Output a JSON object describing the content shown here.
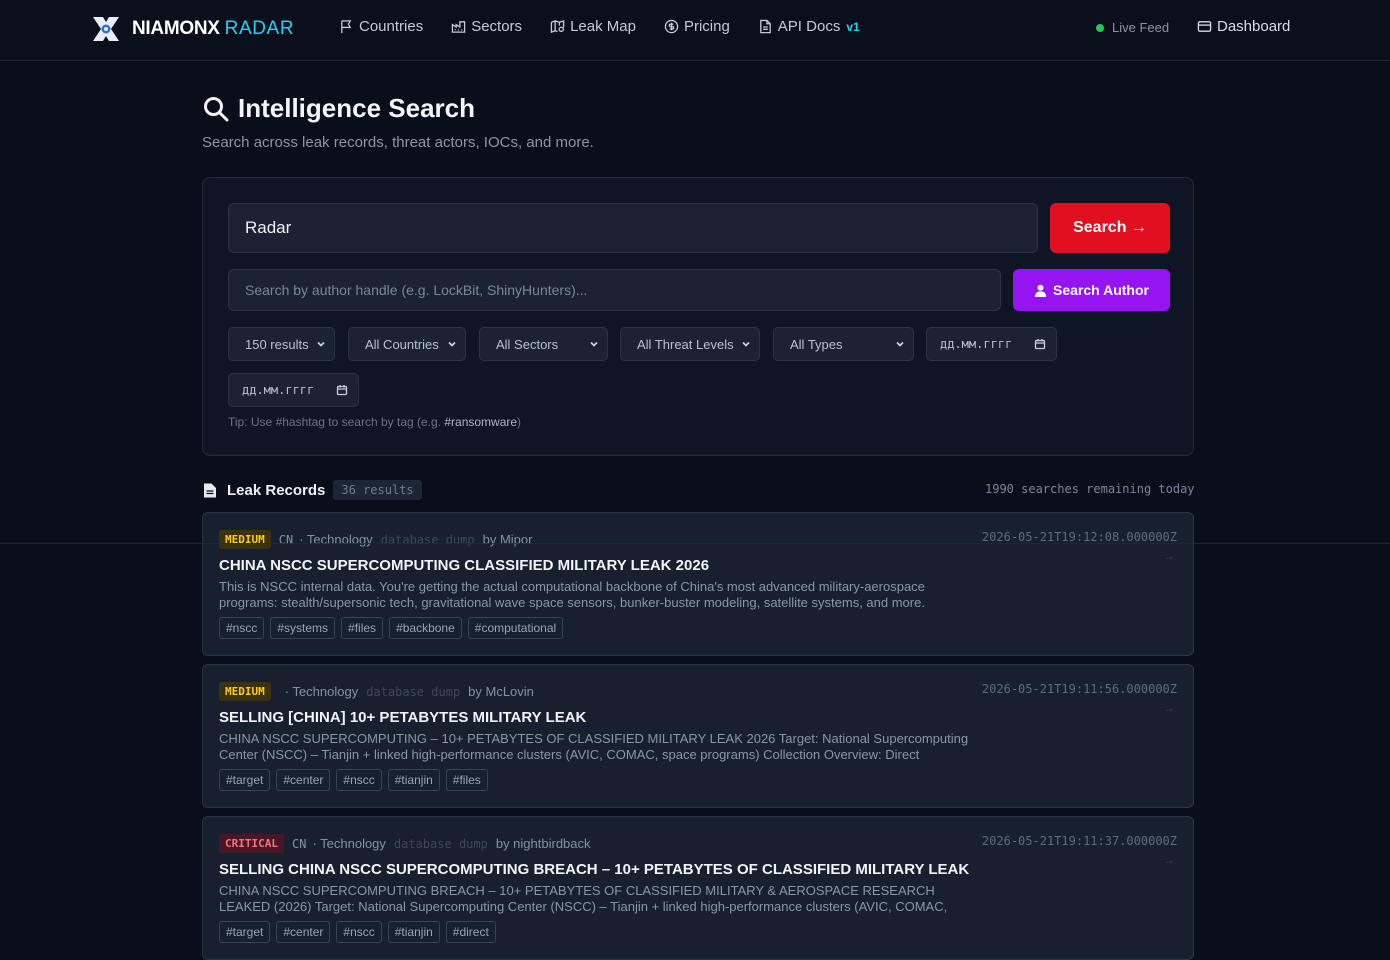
{
  "nav": {
    "logo_main": "NIAMONX",
    "logo_accent": "RADAR",
    "links": [
      {
        "label": "Countries",
        "icon": "flag-icon"
      },
      {
        "label": "Sectors",
        "icon": "factory-icon"
      },
      {
        "label": "Leak Map",
        "icon": "map-pin-icon"
      },
      {
        "label": "Pricing",
        "icon": "dollar-circle-icon"
      },
      {
        "label": "API Docs",
        "icon": "document-icon",
        "badge": "v1"
      }
    ],
    "live_feed": "Live Feed",
    "dashboard": "Dashboard"
  },
  "header": {
    "title": "Intelligence Search",
    "subtitle": "Search across leak records, threat actors, IOCs, and more."
  },
  "search": {
    "query": "Radar",
    "search_button": "Search →",
    "author_placeholder": "Search by author handle (e.g. LockBit, ShinyHunters)...",
    "author_button": "Search Author",
    "filters": {
      "results": "150 results",
      "countries": "All Countries",
      "sectors": "All Sectors",
      "threat_levels": "All Threat Levels",
      "types": "All Types",
      "date_from": "дд.мм.гггг",
      "date_to": "дд.мм.гггг"
    },
    "tip_prefix": "Tip: Use #hashtag to search by tag (e.g. ",
    "tip_example": "#ransomware",
    "tip_suffix": ")"
  },
  "results": {
    "title": "Leak Records",
    "count": "36 results",
    "remaining": "1990 searches remaining today",
    "records": [
      {
        "severity": "MEDIUM",
        "country": "CN",
        "sector": "· Technology",
        "type": "database dump",
        "author": "by Mipor",
        "timestamp": "2026-05-21T19:12:08.000000Z",
        "arrow": "→",
        "title": "CHINA NSCC SUPERCOMPUTING CLASSIFIED MILITARY LEAK 2026",
        "description": "This is NSCC internal data. You're getting the actual computational backbone of China's most advanced military-aerospace programs: stealth/supersonic tech, gravitational wave space sensors, bunker-buster modeling, satellite systems, and more. Proof...",
        "tags": [
          "#nscc",
          "#systems",
          "#files",
          "#backbone",
          "#computational"
        ]
      },
      {
        "severity": "MEDIUM",
        "country": "",
        "sector": "· Technology",
        "type": "database dump",
        "author": "by McLovin",
        "timestamp": "2026-05-21T19:11:56.000000Z",
        "arrow": "→",
        "title": "SELLING [CHINA] 10+ PETABYTES MILITARY LEAK",
        "description": "CHINA NSCC SUPERCOMPUTING – 10+ PETABYTES OF CLASSIFIED MILITARY LEAK 2026 Target: National Supercomputing Center (NSCC) – Tianjin + linked high-performance clusters (AVIC, COMAC, space programs) Collection Overview: Direct exfiltration fro...",
        "tags": [
          "#target",
          "#center",
          "#nscc",
          "#tianjin",
          "#files"
        ]
      },
      {
        "severity": "CRITICAL",
        "country": "CN",
        "sector": "· Technology",
        "type": "database dump",
        "author": "by nightbirdback",
        "timestamp": "2026-05-21T19:11:37.000000Z",
        "arrow": "→",
        "title": "SELLING CHINA NSCC SUPERCOMPUTING BREACH – 10+ PETABYTES OF CLASSIFIED MILITARY LEAK",
        "description": "CHINA NSCC SUPERCOMPUTING BREACH – 10+ PETABYTES OF CLASSIFIED MILITARY & AEROSPACE RESEARCH LEAKED (2026) Target: National Supercomputing Center (NSCC) – Tianjin + linked high-performance clusters (AVIC, COMAC, space programs)...",
        "tags": [
          "#target",
          "#center",
          "#nscc",
          "#tianjin",
          "#direct"
        ]
      }
    ]
  }
}
